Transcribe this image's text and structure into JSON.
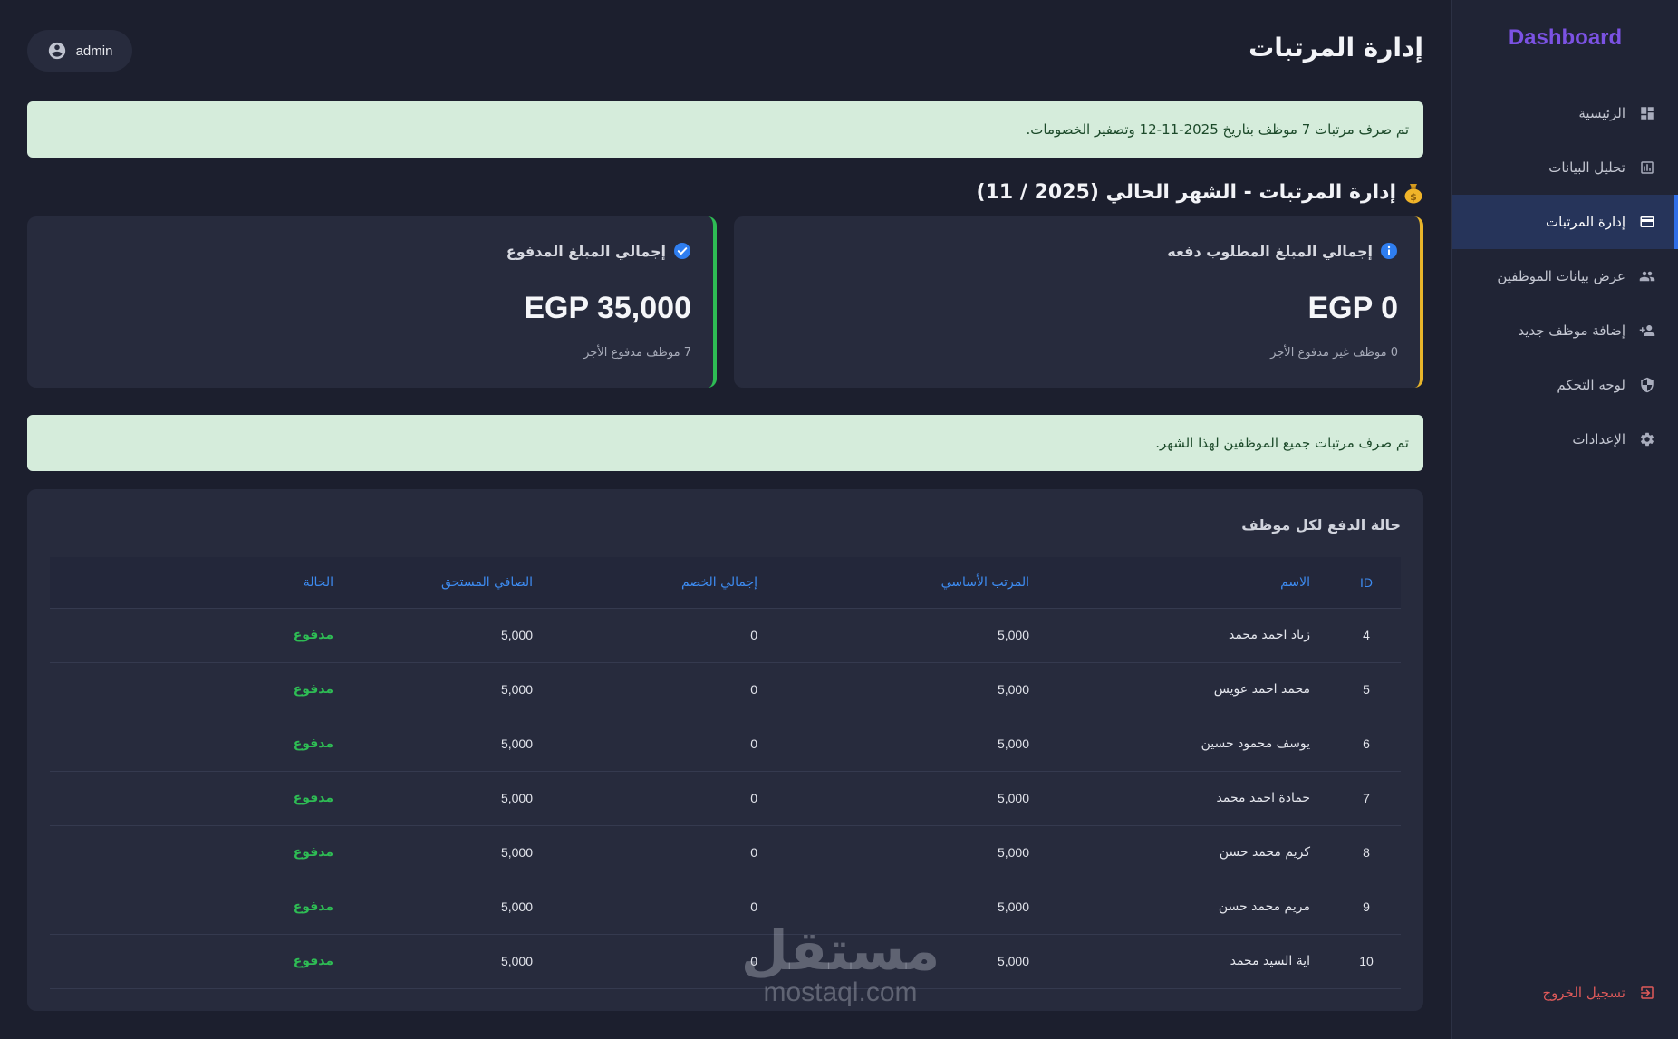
{
  "sidebar": {
    "brand": "Dashboard",
    "items": [
      {
        "label": "الرئيسية",
        "icon": "dashboard-icon"
      },
      {
        "label": "تحليل البيانات",
        "icon": "chart-icon"
      },
      {
        "label": "إدارة المرتبات",
        "icon": "credit-card-icon",
        "active": true
      },
      {
        "label": "عرض بيانات الموظفين",
        "icon": "people-icon"
      },
      {
        "label": "إضافة موظف جديد",
        "icon": "person-add-icon"
      },
      {
        "label": "لوحه التحكم",
        "icon": "shield-icon"
      },
      {
        "label": "الإعدادات",
        "icon": "gear-icon"
      }
    ],
    "logout": "تسجيل الخروج"
  },
  "header": {
    "title": "إدارة المرتبات",
    "user": "admin"
  },
  "alerts": {
    "payout_done": "تم صرف مرتبات 7 موظف بتاريخ 2025-11-12 وتصفير الخصومات.",
    "all_paid": "تم صرف مرتبات جميع الموظفين لهذا الشهر."
  },
  "section": {
    "title": "إدارة المرتبات - الشهر الحالي (2025 / 11)"
  },
  "cards": {
    "due": {
      "title": "إجمالي المبلغ المطلوب دفعه",
      "value": "EGP 0",
      "sub": "0 موظف غير مدفوع الأجر",
      "accent": "#e8b52a"
    },
    "paid": {
      "title": "إجمالي المبلغ المدفوع",
      "value": "EGP 35,000",
      "sub": "7 موظف مدفوع الأجر",
      "accent": "#2ebc54"
    }
  },
  "table": {
    "title": "حالة الدفع لكل موظف",
    "headers": [
      "ID",
      "الاسم",
      "المرتب الأساسي",
      "إجمالي الخصم",
      "الصافي المستحق",
      "الحالة"
    ],
    "rows": [
      [
        "4",
        "زياد احمد محمد",
        "5,000",
        "0",
        "5,000",
        "مدفوع"
      ],
      [
        "5",
        "محمد احمد عويس",
        "5,000",
        "0",
        "5,000",
        "مدفوع"
      ],
      [
        "6",
        "يوسف محمود حسين",
        "5,000",
        "0",
        "5,000",
        "مدفوع"
      ],
      [
        "7",
        "حمادة احمد محمد",
        "5,000",
        "0",
        "5,000",
        "مدفوع"
      ],
      [
        "8",
        "كريم محمد حسن",
        "5,000",
        "0",
        "5,000",
        "مدفوع"
      ],
      [
        "9",
        "مريم محمد حسن",
        "5,000",
        "0",
        "5,000",
        "مدفوع"
      ],
      [
        "10",
        "اية السيد محمد",
        "5,000",
        "0",
        "5,000",
        "مدفوع"
      ]
    ]
  },
  "watermark": {
    "arabic": "مستقل",
    "latin": "mostaql.com"
  },
  "colors": {
    "background": "#1c1f2e",
    "panel": "#272b3d",
    "brand": "#7b52e3",
    "link": "#3d8bf0",
    "success": "#2ebc54",
    "danger": "#e05a5a"
  }
}
